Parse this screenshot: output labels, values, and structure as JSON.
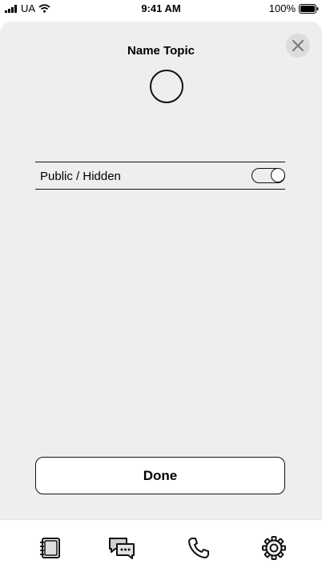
{
  "status_bar": {
    "carrier": "UA",
    "time": "9:41 AM",
    "battery": "100%"
  },
  "sheet": {
    "title": "Name Topic",
    "toggle_label": "Public / Hidden",
    "toggle_on": true,
    "done_label": "Done"
  },
  "tab_bar": {
    "icons": [
      "notebook-icon",
      "chat-bubbles-icon",
      "phone-icon",
      "gear-icon"
    ]
  },
  "colors": {
    "sheet_background": "#eeeeee",
    "close_button_background": "#dcdcdc"
  }
}
